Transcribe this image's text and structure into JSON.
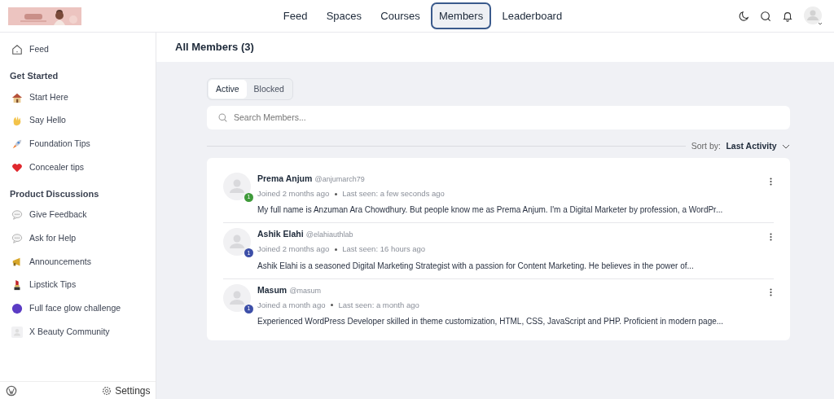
{
  "header": {
    "nav": [
      {
        "label": "Feed",
        "selected": false
      },
      {
        "label": "Spaces",
        "selected": false
      },
      {
        "label": "Courses",
        "selected": false
      },
      {
        "label": "Members",
        "selected": true
      },
      {
        "label": "Leaderboard",
        "selected": false
      }
    ]
  },
  "sidebar": {
    "items": [
      {
        "kind": "home",
        "label": "Feed"
      },
      {
        "kind": "heading",
        "label": "Get Started"
      },
      {
        "kind": "house",
        "label": "Start Here"
      },
      {
        "kind": "wave",
        "label": "Say Hello"
      },
      {
        "kind": "rocket",
        "label": "Foundation Tips"
      },
      {
        "kind": "heart",
        "label": "Concealer tips"
      },
      {
        "kind": "heading",
        "label": "Product Discussions"
      },
      {
        "kind": "speech",
        "label": "Give Feedback"
      },
      {
        "kind": "speech",
        "label": "Ask for Help"
      },
      {
        "kind": "megaphone",
        "label": "Announcements"
      },
      {
        "kind": "lipstick",
        "label": "Lipstick Tips"
      },
      {
        "kind": "dot",
        "label": "Full face glow challenge"
      },
      {
        "kind": "avatar",
        "label": "X Beauty Community"
      }
    ],
    "footer": {
      "settings": "Settings"
    }
  },
  "page": {
    "title": "All Members (3)",
    "tabs": [
      {
        "label": "Active",
        "selected": true
      },
      {
        "label": "Blocked",
        "selected": false
      }
    ],
    "search": {
      "placeholder": "Search Members..."
    },
    "sort": {
      "label": "Sort by:",
      "value": "Last Activity"
    },
    "members": [
      {
        "name": "Prema Anjum",
        "handle": "@anjumarch79",
        "joined": "Joined 2 months ago",
        "last_seen": "Last seen: a few seconds ago",
        "bio": "My full name is Anzuman Ara Chowdhury. But people know me as Prema Anjum. I'm a Digital Marketer by profession, a WordPr...",
        "level": "1",
        "color": "#3f9a3a"
      },
      {
        "name": "Ashik Elahi",
        "handle": "@elahiauthlab",
        "joined": "Joined 2 months ago",
        "last_seen": "Last seen: 16 hours ago",
        "bio": "Ashik Elahi is a seasoned Digital Marketing Strategist with a passion for Content Marketing. He believes in the power of...",
        "level": "1",
        "color": "#3d4fa8"
      },
      {
        "name": "Masum",
        "handle": "@masum",
        "joined": "Joined a month ago",
        "last_seen": "Last seen: a month ago",
        "bio": "Experienced WordPress Developer skilled in theme customization, HTML, CSS, JavaScript and PHP. Proficient in modern page...",
        "level": "1",
        "color": "#3d4fa8"
      }
    ]
  }
}
